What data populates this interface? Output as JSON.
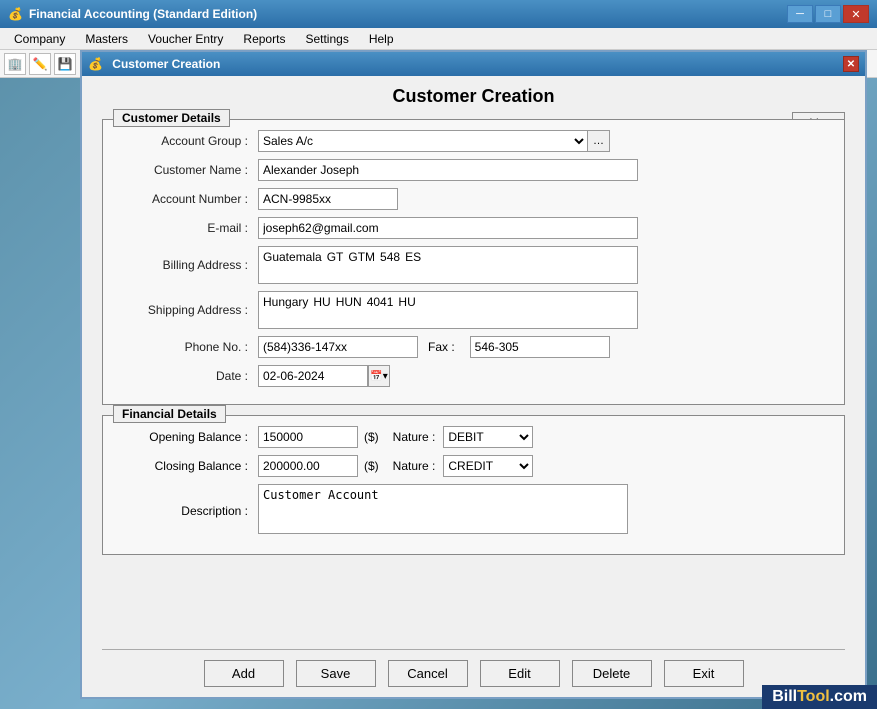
{
  "window": {
    "title": "Financial Accounting (Standard Edition)",
    "dialog_title": "Customer Creation"
  },
  "menubar": {
    "items": [
      "Company",
      "Masters",
      "Voucher Entry",
      "Reports",
      "Settings",
      "Help"
    ]
  },
  "dialog": {
    "main_title": "Customer Creation",
    "list_button": "List"
  },
  "customer_details": {
    "section_label": "Customer Details",
    "account_group_label": "Account Group :",
    "account_group_value": "Sales A/c",
    "customer_name_label": "Customer Name :",
    "customer_name_value": "Alexander Joseph",
    "account_number_label": "Account Number :",
    "account_number_value": "ACN-9985xx",
    "email_label": "E-mail :",
    "email_value": "joseph62@gmail.com",
    "billing_address_label": "Billing Address :",
    "billing_address": {
      "country": "Guatemala",
      "state_code": "GT",
      "city": "GTM",
      "zip": "548",
      "extra": "ES"
    },
    "shipping_address_label": "Shipping Address :",
    "shipping_address": {
      "country": "Hungary",
      "state_code": "HU",
      "city": "HUN",
      "zip": "4041",
      "extra": "HU"
    },
    "phone_label": "Phone No. :",
    "phone_value": "(584)336-147xx",
    "fax_label": "Fax :",
    "fax_value": "546-305",
    "date_label": "Date :",
    "date_value": "02-06-2024"
  },
  "financial_details": {
    "section_label": "Financial Details",
    "opening_balance_label": "Opening Balance :",
    "opening_balance_value": "150000",
    "closing_balance_label": "Closing Balance :",
    "closing_balance_value": "200000.00",
    "currency": "($)",
    "nature_label": "Nature :",
    "opening_nature_value": "DEBIT",
    "closing_nature_value": "CREDIT",
    "nature_options": [
      "DEBIT",
      "CREDIT"
    ],
    "description_label": "Description :",
    "description_value": "Customer Account"
  },
  "buttons": {
    "add": "Add",
    "save": "Save",
    "cancel": "Cancel",
    "edit": "Edit",
    "delete": "Delete",
    "exit": "Exit"
  },
  "watermark": {
    "bill": "Bill",
    "tool": "Tool",
    "domain": ".com"
  }
}
